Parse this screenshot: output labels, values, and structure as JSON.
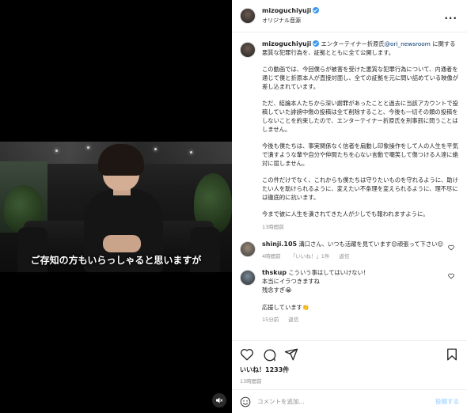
{
  "video": {
    "subtitle": "ご存知の方もいらっしゃると思いますが"
  },
  "header": {
    "username": "mizoguchiyuji",
    "audio_label": "オリジナル音源"
  },
  "caption": {
    "username": "mizoguchiyuji",
    "intro": " エンターテイナー折原氏",
    "mention": "@ori_newsroom",
    "intro_rest": " に関する悪質な犯罪行為を、証拠とともに全て公開します。",
    "p1": "この動画では、今回僕らが被害を受けた悪質な犯罪行為について、内通者を通じて僕と折原本人が直接対面し、全ての証拠を元に問い詰めている映像が差し込まれています。",
    "p2": "ただ、結論本人たちから深い謝罪があったことと過去に当該アカウントで投稿していた誹謗中傷の投稿は全て削除すること、今後も一切その類の投稿をしないことを約束したので、エンターテイナー折原氏を刑事罰に問うことはしません。",
    "p3": "今後も僕たちは、事実関係なく信者を扇動し印象操作をして人の人生を平気で潰すような輩や自分や仲間たちを心ない言動で嘲笑して傷つける人達に絶対に屈しません。",
    "p4": "この件だけでなく、これからも僕たちは守りたいものを守れるように、助けたい人を助けられるように、変えたい不条理を変えられるように、理不尽には徹底的に抗います。",
    "p5": "今まで彼に人生を潰されてきた人が少しでも報われますように。",
    "time": "13時間前"
  },
  "comments": [
    {
      "username": "shinji.105",
      "text": " 溝口さん、いつも活躍を見ています😊頑張って下さい😊",
      "time": "4時間前",
      "likes": "「いいね！」1件",
      "reply": "返信"
    },
    {
      "username": "thskup",
      "text": " こういう事はしてはいけない！\n本当にイラつきますね\n残念すぎ😭\n\n応援しています👏",
      "time": "15分前",
      "reply": "返信"
    }
  ],
  "footer": {
    "likes": "いいね！1233件",
    "time": "13時間前",
    "comment_placeholder": "コメントを追加...",
    "post_label": "投稿する"
  }
}
